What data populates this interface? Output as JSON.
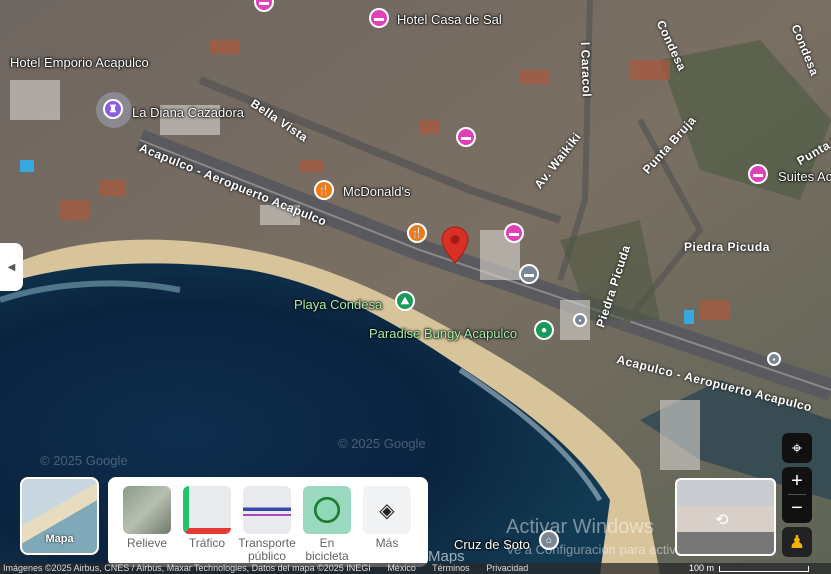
{
  "map": {
    "places": {
      "hotel_casa_de_sal": "Hotel Casa de Sal",
      "hotel_emporio": "Hotel Emporio Acapulco",
      "la_diana": "La Diana Cazadora",
      "mcdonalds": "McDonald's",
      "suites": "Suites Ac",
      "playa_condesa": "Playa Condesa",
      "paradise_bungy": "Paradise Bungy Acapulco",
      "cruz_de_soto": "Cruz de Soto"
    },
    "roads": {
      "bella_vista": "Bella Vista",
      "aeropuerto_1": "Acapulco - Aeropuerto Acapulco",
      "aeropuerto_2": "Acapulco - Aeropuerto Acapulco",
      "waikiki": "Av. Waikiki",
      "punta_bruja": "Punta Bruja",
      "condesa_1": "Condesa",
      "condesa_2": "Condesa",
      "piedra_picuda_1": "Piedra Picuda",
      "piedra_picuda_2": "Piedra Picuda",
      "caracol": "l Caracol",
      "punta_p": "Punta P"
    },
    "watermarks": [
      "© 2025 Google",
      "© 2025 Google"
    ]
  },
  "windows_notice": {
    "title": "Activar Windows",
    "subtitle": "Ve a Configuración para activar Windows."
  },
  "maps_text": "Maps",
  "basemap_toggle": {
    "label": "Mapa"
  },
  "layers": [
    {
      "label": "Relieve"
    },
    {
      "label": "Tráfico"
    },
    {
      "label": "Transporte público"
    },
    {
      "label": "En bicicleta"
    },
    {
      "label": "Más"
    }
  ],
  "footer": {
    "attribution": "Imágenes ©2025 Airbus, CNES / Airbus, Maxar Technologies, Datos del mapa ©2025 INEGI",
    "country": "México",
    "terms": "Términos",
    "privacy": "Privacidad",
    "scale": "100 m"
  },
  "controls": {
    "zoom_in": "+",
    "zoom_out": "−"
  },
  "colors": {
    "hotel": "#e040b8",
    "food": "#f07b15",
    "park": "#1a9a5a",
    "pin": "#d93025"
  }
}
